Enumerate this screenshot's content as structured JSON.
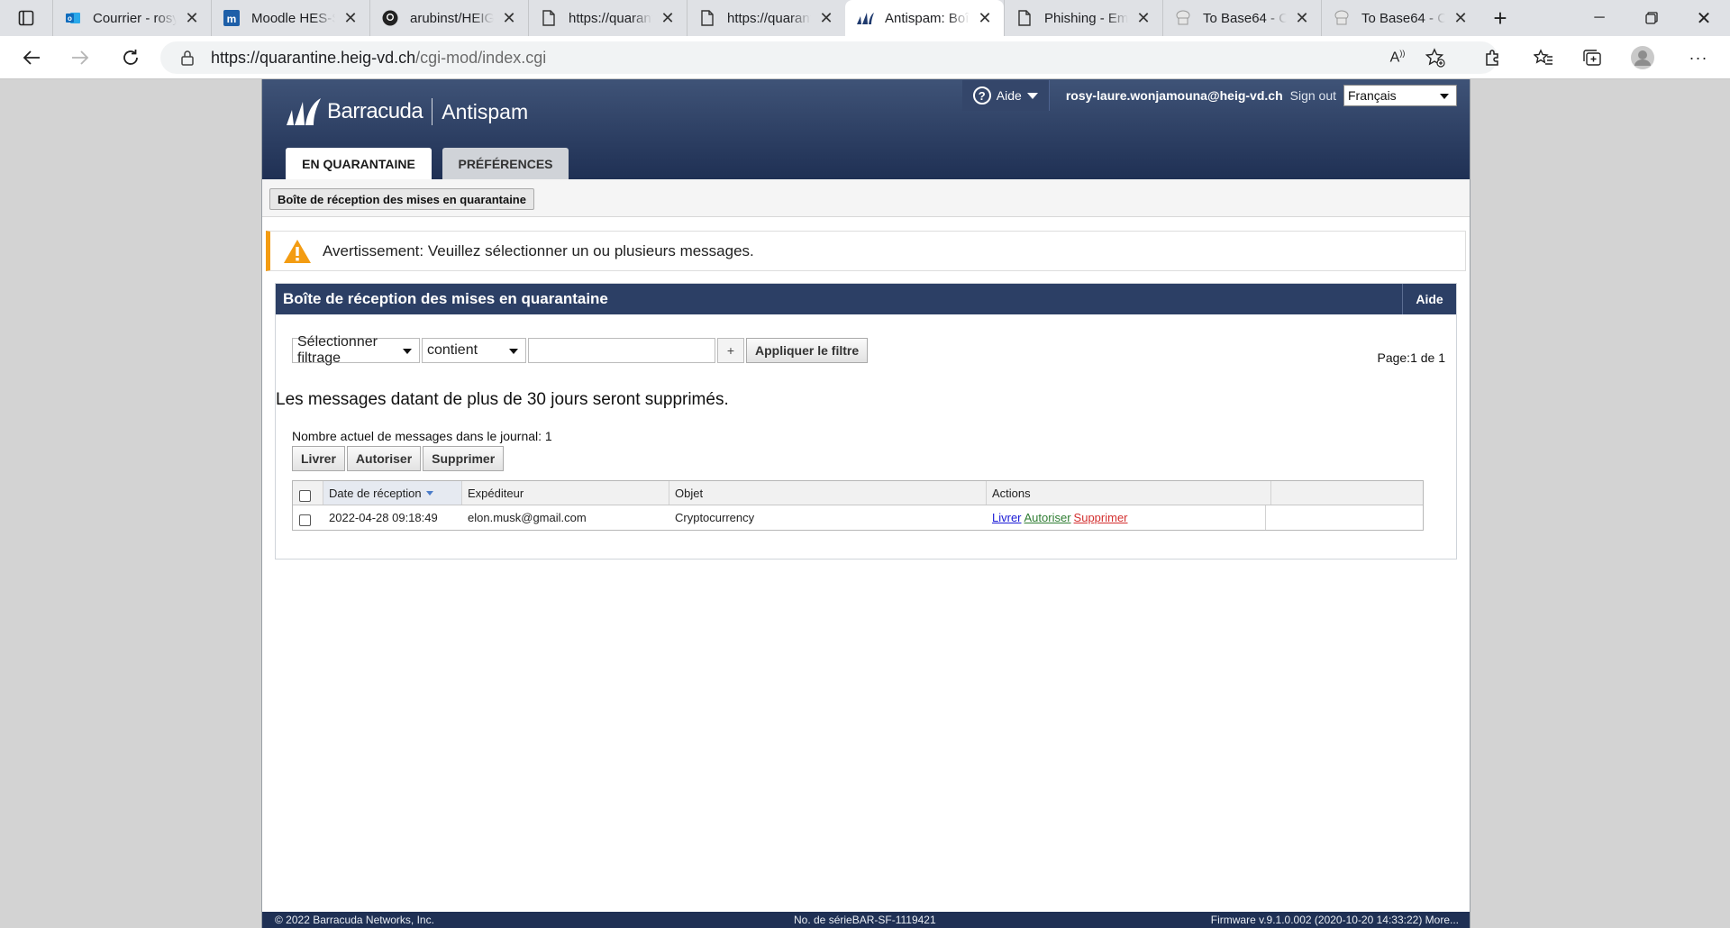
{
  "browser": {
    "tabs": [
      {
        "title": "Courrier - rosy-laure",
        "icon": "outlook-icon"
      },
      {
        "title": "Moodle HES-SO",
        "icon": "moodle-icon"
      },
      {
        "title": "arubinst/HEIG-VD",
        "icon": "github-icon"
      },
      {
        "title": "https://quarantine",
        "icon": "page-icon"
      },
      {
        "title": "https://quarantine",
        "icon": "page-icon"
      },
      {
        "title": "Antispam: Boîte",
        "icon": "barracuda-icon",
        "active": true
      },
      {
        "title": "Phishing - Email",
        "icon": "page-icon"
      },
      {
        "title": "To Base64 - CyberChef",
        "icon": "chef-icon"
      },
      {
        "title": "To Base64 - CyberChef",
        "icon": "chef-icon"
      }
    ],
    "address": {
      "host": "https://quarantine.heig-vd.ch",
      "path": "/cgi-mod/index.cgi"
    }
  },
  "header": {
    "brand": "Barracuda",
    "product": "Antispam",
    "aide": "Aide",
    "user": "rosy-laure.wonjamouna@heig-vd.ch",
    "sign_out": "Sign out",
    "language": "Français",
    "tabs": {
      "quarantine": "EN QUARANTAINE",
      "preferences": "PRÉFÉRENCES"
    }
  },
  "breadcrumb": "Boîte de réception des mises en quarantaine",
  "warning": "Avertissement: Veuillez sélectionner un ou plusieurs messages.",
  "panel": {
    "title": "Boîte de réception des mises en quarantaine",
    "aide": "Aide",
    "filter": {
      "field": "Sélectionner filtrage",
      "operator": "contient",
      "value": "",
      "plus": "+",
      "apply": "Appliquer le filtre"
    },
    "page_info": "Page:1 de 1",
    "notice": "Les messages datant de plus de 30 jours seront supprimés.",
    "count_text": "Nombre actuel de messages dans le journal: 1",
    "buttons": {
      "deliver": "Livrer",
      "allow": "Autoriser",
      "delete": "Supprimer"
    },
    "columns": {
      "date": "Date de réception",
      "sender": "Expéditeur",
      "subject": "Objet",
      "actions": "Actions"
    },
    "rows": [
      {
        "date": "2022-04-28 09:18:49",
        "sender": "elon.musk@gmail.com",
        "subject": "Cryptocurrency",
        "actions": {
          "deliver": "Livrer",
          "allow": "Autoriser",
          "delete": "Supprimer"
        }
      }
    ]
  },
  "footer": {
    "copyright": "© 2022 Barracuda Networks, Inc.",
    "serial": "No. de sérieBAR-SF-1119421",
    "firmware": "Firmware v.9.1.0.002 (2020-10-20 14:33:22) More..."
  },
  "colors": {
    "header": "#2c3f65",
    "warning_accent": "#f39c12",
    "link_deliver": "#1a1ad6",
    "link_allow": "#2e7d32",
    "link_delete": "#d32f2f"
  }
}
